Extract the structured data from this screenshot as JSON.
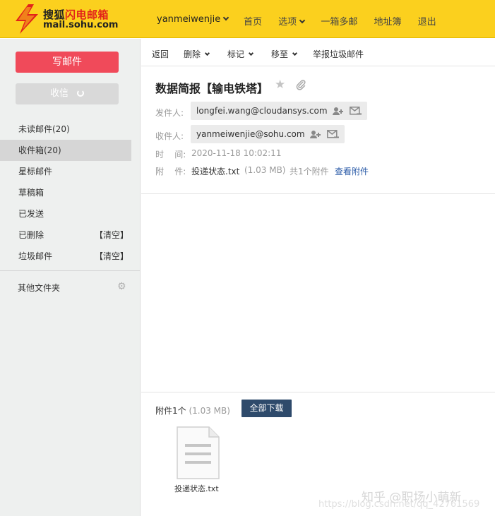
{
  "header": {
    "logo_brand": "搜狐",
    "logo_product": "闪电邮箱",
    "logo_domain": "mail.sohu.com",
    "username": "yanmeiwenjie",
    "nav": [
      "首页",
      "选项",
      "一箱多邮",
      "地址簿",
      "退出"
    ]
  },
  "sidebar": {
    "compose_label": "写邮件",
    "receive_label": "收信",
    "folders": [
      {
        "label": "未读邮件(20)"
      },
      {
        "label": "收件箱(20)"
      },
      {
        "label": "星标邮件"
      },
      {
        "label": "草稿箱"
      },
      {
        "label": "已发送"
      },
      {
        "label": "已删除",
        "action": "【清空】"
      },
      {
        "label": "垃圾邮件",
        "action": "【清空】"
      }
    ],
    "other_folders_label": "其他文件夹"
  },
  "toolbar": {
    "back": "返回",
    "delete": "删除",
    "mark": "标记",
    "move": "移至",
    "report_spam": "举报垃圾邮件"
  },
  "message": {
    "subject": "数据简报【输电铁塔】",
    "from_label": "发件人:",
    "from": "longfei.wang@cloudansys.com",
    "to_label": "收件人:",
    "to": "yanmeiwenjie@sohu.com",
    "time_label": "时    间:",
    "time": "2020-11-18 10:02:11",
    "attach_label": "附    件:",
    "attach_name": "投递状态.txt",
    "attach_size": "(1.03 MB)",
    "attach_count": "共1个附件",
    "view_attach": "查看附件"
  },
  "attachments": {
    "summary": "附件1个",
    "summary_size": "(1.03 MB)",
    "download_all": "全部下载",
    "file_name": "投递状态.txt"
  },
  "watermark": {
    "line1": "知乎 @职场小萌新",
    "line2": "https://blog.csdn.net/qq_42761569"
  },
  "colors": {
    "header_bg": "#fbd01e",
    "compose_btn": "#f04a5a",
    "download_btn": "#2e4a6b",
    "link": "#2b5ba8"
  }
}
